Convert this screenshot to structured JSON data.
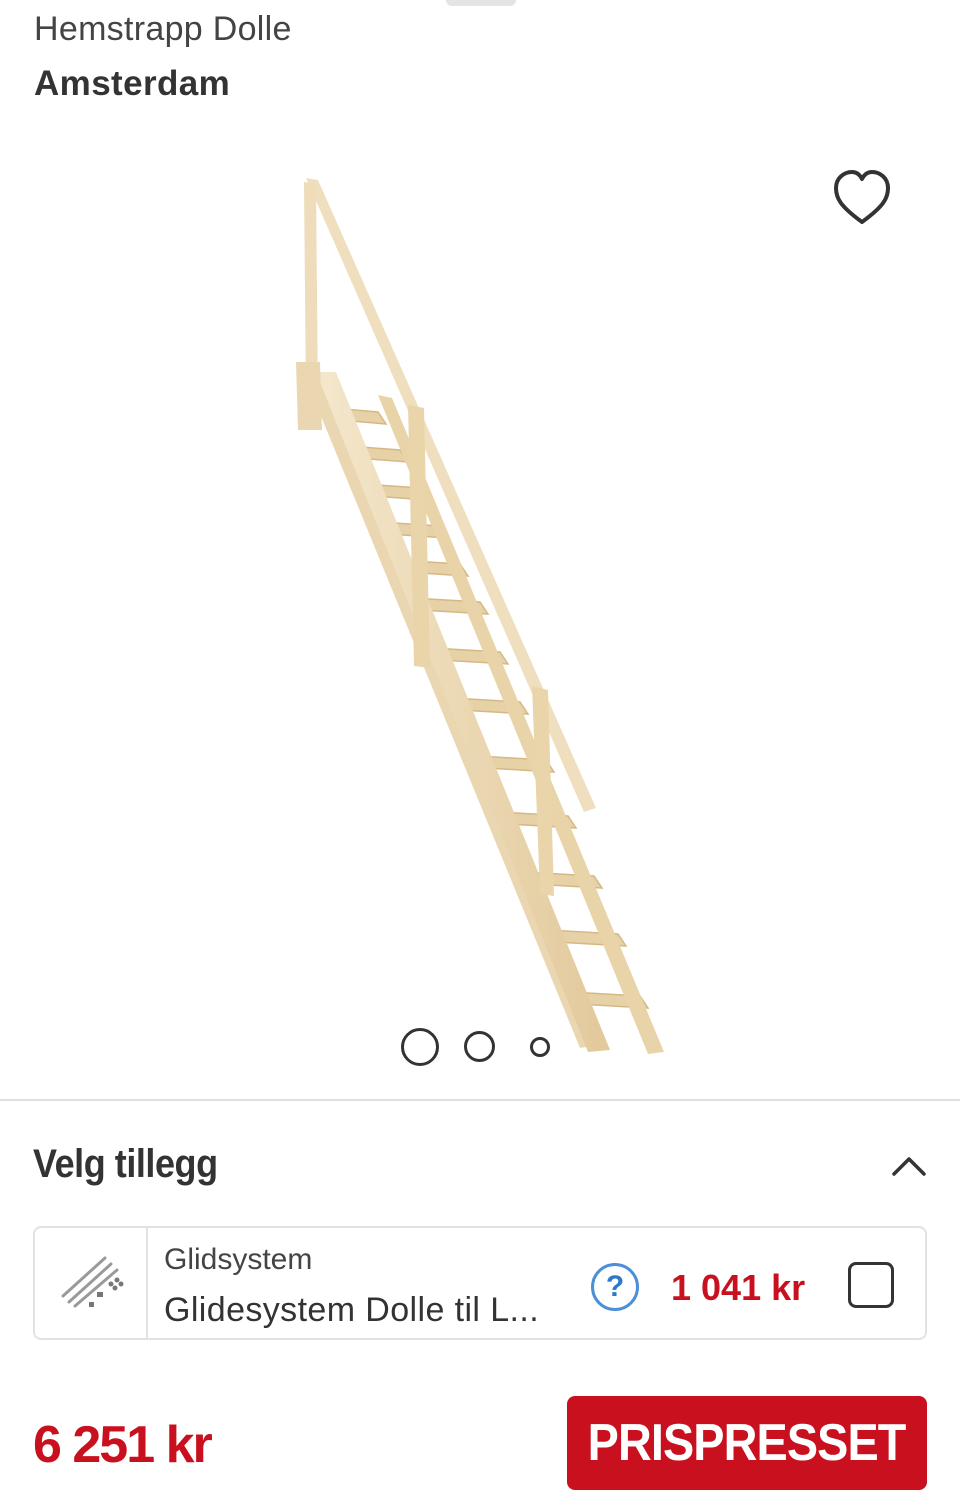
{
  "product": {
    "brand": "Hemstrapp Dolle",
    "name": "Amsterdam"
  },
  "gallery": {
    "image_count": 3,
    "active_index": 0,
    "favorite_icon": "heart-outline-icon"
  },
  "addons": {
    "title": "Velg tillegg",
    "expanded": true,
    "collapse_icon": "chevron-up-icon",
    "items": [
      {
        "category": "Glidsystem",
        "name": "Glidesystem Dolle til L...",
        "help_symbol": "?",
        "price": "1 041 kr",
        "checked": false
      }
    ]
  },
  "footer": {
    "price": "6 251 kr",
    "badge_label": "PRISPRESSET"
  },
  "colors": {
    "accent_red": "#c8101e",
    "help_blue": "#2f78c6",
    "wood": "#ecd9b3"
  }
}
